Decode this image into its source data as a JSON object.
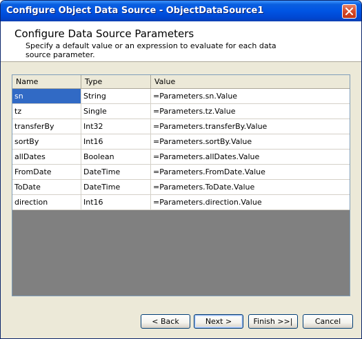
{
  "window": {
    "title": "Configure Object Data Source - ObjectDataSource1"
  },
  "header": {
    "title": "Configure Data Source Parameters",
    "description": "Specify a default value or an expression to evaluate for each data source parameter."
  },
  "grid": {
    "columns": [
      "Name",
      "Type",
      "Value"
    ],
    "rows": [
      {
        "name": "sn",
        "type": "String",
        "value": "=Parameters.sn.Value"
      },
      {
        "name": "tz",
        "type": "Single",
        "value": "=Parameters.tz.Value"
      },
      {
        "name": "transferBy",
        "type": "Int32",
        "value": "=Parameters.transferBy.Value"
      },
      {
        "name": "sortBy",
        "type": "Int16",
        "value": "=Parameters.sortBy.Value"
      },
      {
        "name": "allDates",
        "type": "Boolean",
        "value": "=Parameters.allDates.Value"
      },
      {
        "name": "FromDate",
        "type": "DateTime",
        "value": "=Parameters.FromDate.Value"
      },
      {
        "name": "ToDate",
        "type": "DateTime",
        "value": "=Parameters.ToDate.Value"
      },
      {
        "name": "direction",
        "type": "Int16",
        "value": "=Parameters.direction.Value"
      }
    ]
  },
  "buttons": {
    "back": "< Back",
    "next": "Next >",
    "finish": "Finish >>|",
    "cancel": "Cancel"
  },
  "colors": {
    "titlebar": "#0054e3",
    "selection": "#316ac5",
    "grid_background": "#808080",
    "dialog_face": "#ece9d8"
  }
}
